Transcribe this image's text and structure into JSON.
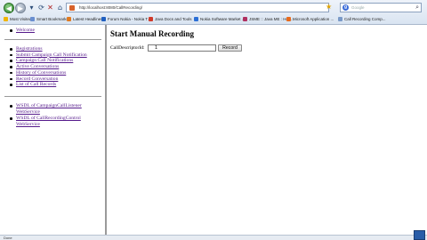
{
  "browser": {
    "url": "http://localhost:8080/CallRecording/",
    "search_placeholder": "Google",
    "search_engine_glyph": "g",
    "bookmarks": [
      {
        "label": "Most Visited",
        "color": "#f0b400"
      },
      {
        "label": "Smart Bookmarks",
        "color": "#6a8fd0"
      },
      {
        "label": "Latest Headlines",
        "color": "#e07a20"
      },
      {
        "label": "Forum Nokia - Nokia T...",
        "color": "#2060c0"
      },
      {
        "label": "Java Docs and Tools",
        "color": "#d03a2a"
      },
      {
        "label": "Nokia Software Market ...",
        "color": "#2b6fd6"
      },
      {
        "label": "JSME :: Java ME : Hov...",
        "color": "#b03060"
      },
      {
        "label": "Microsoft Application ...",
        "color": "#e86a1c"
      },
      {
        "label": "Call Recording Comp...",
        "color": "#7a9ac8"
      }
    ],
    "status": "Done"
  },
  "nav": {
    "top_items": [
      {
        "label": "Welcome"
      }
    ],
    "main_items": [
      {
        "label": "Registrations"
      },
      {
        "label": "Submit Campaign Call Notification"
      },
      {
        "label": "Campaign Call Notifications"
      },
      {
        "label": "Active Conversations"
      },
      {
        "label": "History of Conversations"
      },
      {
        "label": "Record Conversation"
      },
      {
        "label": "List of Call Records"
      }
    ],
    "wsdl_items": [
      {
        "label": "WSDL of CampaignCallListener WebService"
      },
      {
        "label": "WSDL of CallRecordingControl WebService"
      }
    ]
  },
  "main": {
    "heading": "Start Manual Recording",
    "field_label": "CallDescriptorId:",
    "field_value": "1",
    "button_label": "Record"
  }
}
